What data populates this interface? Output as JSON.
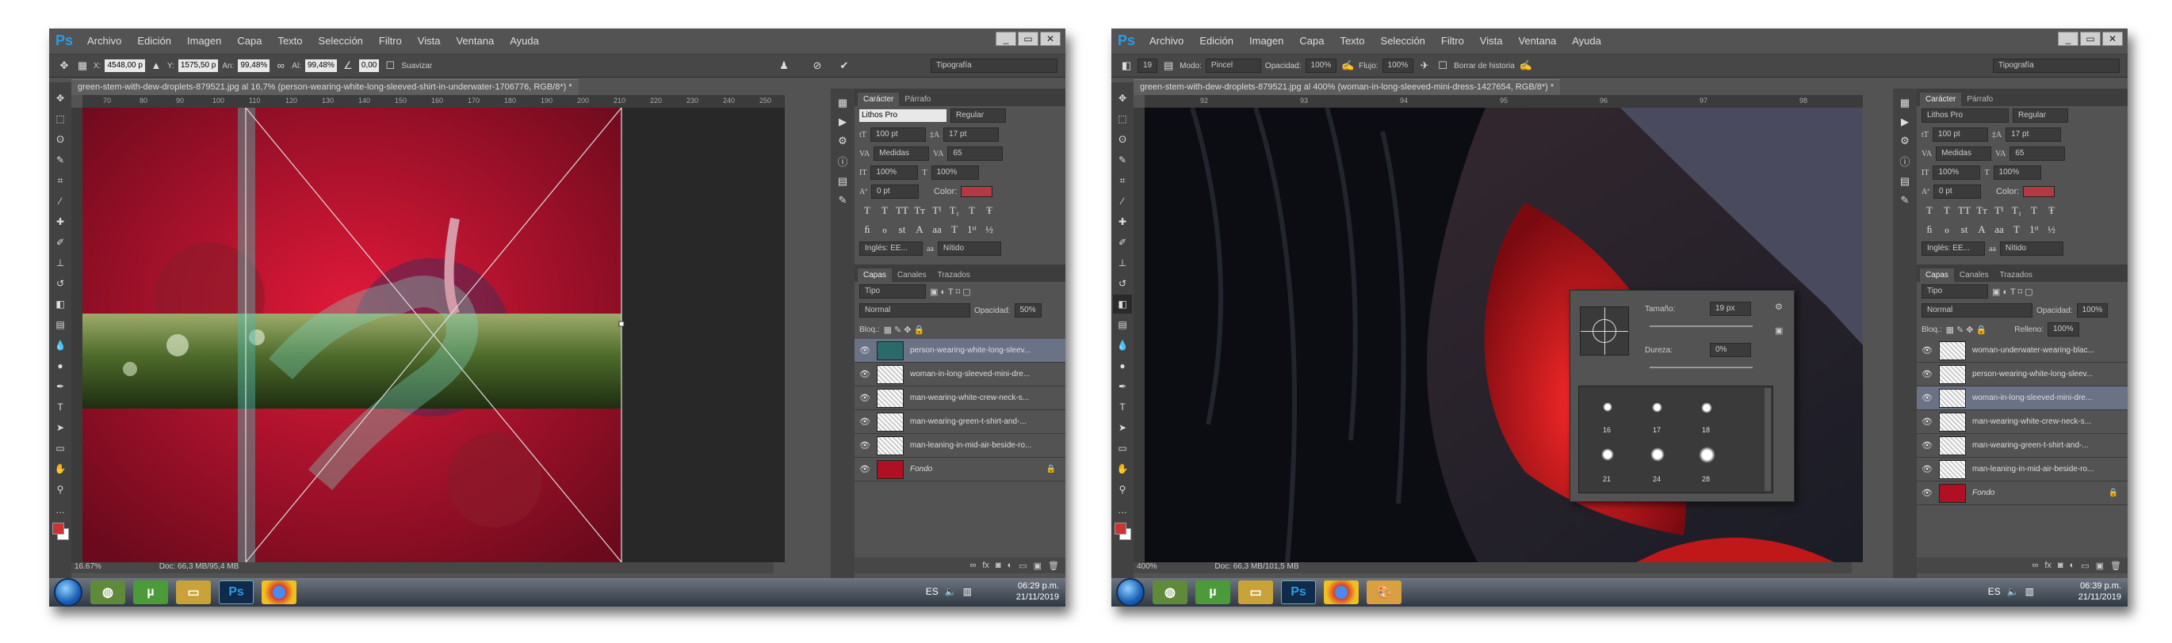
{
  "menu": [
    "Archivo",
    "Edición",
    "Imagen",
    "Capa",
    "Texto",
    "Selección",
    "Filtro",
    "Vista",
    "Ventana",
    "Ayuda"
  ],
  "window_controls": [
    "_",
    "▭",
    "✕"
  ],
  "w1": {
    "options": {
      "x_label": "X:",
      "x_value": "4548,00 p",
      "y_label": "Y:",
      "y_value": "1575,50 p",
      "w_label": "An:",
      "w_value": "99,48%",
      "h_label": "Al:",
      "h_value": "99,48%",
      "angle_value": "0,00",
      "smooth_label": "Suavizar",
      "workspace": "Tipografía"
    },
    "doc_tab": "green-stem-with-dew-droplets-879521.jpg al 16,7% (person-wearing-white-long-sleeved-shirt-in-underwater-1706776, RGB/8*) *",
    "ruler": [
      "70",
      "80",
      "90",
      "100",
      "110",
      "120",
      "130",
      "140",
      "150",
      "160",
      "170",
      "180",
      "190",
      "200",
      "210",
      "220",
      "230",
      "240",
      "250"
    ],
    "zoom": "16.67%",
    "doc_info": "Doc: 66,3 MB/95,4 MB",
    "character": {
      "tabs": [
        "Carácter",
        "Párrafo"
      ],
      "font": "Lithos Pro",
      "style": "Regular",
      "size": "100 pt",
      "leading": "17 pt",
      "kerning": "Medidas",
      "tracking": "65",
      "vscale": "100%",
      "hscale": "100%",
      "baseline": "0 pt",
      "color_label": "Color:",
      "language": "Inglés: EE...",
      "aa_label": "aa",
      "aa_value": "Nítido"
    },
    "layers_tabs": [
      "Capas",
      "Canales",
      "Trazados"
    ],
    "kind": "Tipo",
    "blend": "Normal",
    "opacity_label": "Opacidad:",
    "opacity": "50%",
    "lock_label": "Bloq.:",
    "layers": [
      {
        "name": "person-wearing-white-long-sleev...",
        "selected": true
      },
      {
        "name": "woman-in-long-sleeved-mini-dre...",
        "selected": false
      },
      {
        "name": "man-wearing-white-crew-neck-s...",
        "selected": false
      },
      {
        "name": "man-wearing-green-t-shirt-and-...",
        "selected": false
      },
      {
        "name": "man-leaning-in-mid-air-beside-ro...",
        "selected": false
      },
      {
        "name": "Fondo",
        "selected": false
      }
    ],
    "clock_time": "06:29 p.m.",
    "clock_date": "21/11/2019"
  },
  "w2": {
    "options": {
      "brush_size": "19",
      "mode_label": "Modo:",
      "mode": "Pincel",
      "opacity_label": "Opacidad:",
      "opacity": "100%",
      "flow_label": "Flujo:",
      "flow": "100%",
      "erase_history_label": "Borrar de historia",
      "workspace": "Tipografía"
    },
    "doc_tab": "green-stem-with-dew-droplets-879521.jpg al 400% (woman-in-long-sleeved-mini-dress-1427654, RGB/8*) *",
    "ruler": [
      "92",
      "93",
      "94",
      "95",
      "96",
      "97",
      "98"
    ],
    "zoom": "400%",
    "doc_info": "Doc: 66,3 MB/101,5 MB",
    "brush": {
      "size_label": "Tamaño:",
      "size": "19 px",
      "hardness_label": "Dureza:",
      "hardness": "0%",
      "presets": [
        "16",
        "17",
        "18",
        "21",
        "24",
        "28"
      ]
    },
    "character": {
      "tabs": [
        "Carácter",
        "Párrafo"
      ],
      "font": "Lithos Pro",
      "style": "Regular",
      "size": "100 pt",
      "leading": "17 pt",
      "kerning": "Medidas",
      "tracking": "65",
      "vscale": "100%",
      "hscale": "100%",
      "baseline": "0 pt",
      "color_label": "Color:",
      "language": "Inglés: EE...",
      "aa_label": "aa",
      "aa_value": "Nítido"
    },
    "layers_tabs": [
      "Capas",
      "Canales",
      "Trazados"
    ],
    "kind": "Tipo",
    "blend": "Normal",
    "opacity_label": "Opacidad:",
    "opacity": "100%",
    "lock_label": "Bloq.:",
    "fill_label": "Relleno:",
    "fill": "100%",
    "layers": [
      {
        "name": "woman-underwater-wearing-blac...",
        "selected": false
      },
      {
        "name": "person-wearing-white-long-sleev...",
        "selected": false
      },
      {
        "name": "woman-in-long-sleeved-mini-dre...",
        "selected": true
      },
      {
        "name": "man-wearing-white-crew-neck-s...",
        "selected": false
      },
      {
        "name": "man-wearing-green-t-shirt-and-...",
        "selected": false
      },
      {
        "name": "man-leaning-in-mid-air-beside-ro...",
        "selected": false
      },
      {
        "name": "Fondo",
        "selected": false
      }
    ],
    "clock_time": "06:39 p.m.",
    "clock_date": "21/11/2019"
  },
  "tray_lang": "ES",
  "ps_logo": "Ps",
  "ps_taskbar": "Ps",
  "colors": {
    "ui": "#535353",
    "selected_layer": "#6a7285",
    "accent_blue": "#2d9be0",
    "canvas_red": "#c0142a"
  }
}
